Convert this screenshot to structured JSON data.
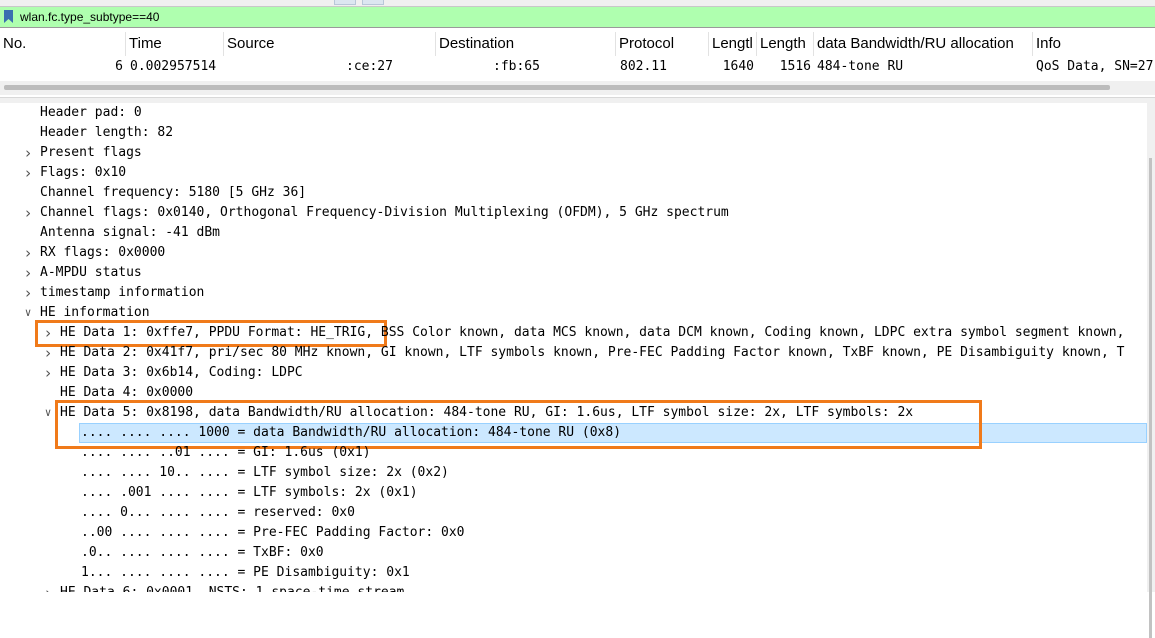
{
  "display_filter": {
    "value": "wlan.fc.type_subtype==40"
  },
  "packet_list": {
    "columns": [
      "No.",
      "Time",
      "Source",
      "Destination",
      "Protocol",
      "Lengtl",
      "Length",
      "data Bandwidth/RU allocation",
      "Info"
    ],
    "row": {
      "no": "6",
      "time": "0.002957514",
      "source": ":ce:27",
      "destination": ":fb:65",
      "protocol": "802.11",
      "length1": "1640",
      "length2": "1516",
      "bandwidth": "484-tone RU",
      "info": "QoS Data, SN=27"
    }
  },
  "details": [
    {
      "text": "Header pad: 0",
      "arrow": "none"
    },
    {
      "text": "Header length: 82",
      "arrow": "none"
    },
    {
      "text": "Present flags",
      "arrow": "collapsed"
    },
    {
      "text": "Flags: 0x10",
      "arrow": "collapsed"
    },
    {
      "text": "Channel frequency: 5180 [5 GHz 36]",
      "arrow": "none"
    },
    {
      "text": "Channel flags: 0x0140, Orthogonal Frequency-Division Multiplexing (OFDM), 5 GHz spectrum",
      "arrow": "collapsed"
    },
    {
      "text": "Antenna signal: -41 dBm",
      "arrow": "none"
    },
    {
      "text": "RX flags: 0x0000",
      "arrow": "collapsed"
    },
    {
      "text": "A-MPDU status",
      "arrow": "collapsed"
    },
    {
      "text": "timestamp information",
      "arrow": "collapsed"
    },
    {
      "text": "HE information",
      "arrow": "expanded"
    },
    {
      "text": "HE Data 1: 0xffe7, PPDU Format: HE_TRIG, BSS Color known, data MCS known, data DCM known, Coding known, LDPC extra symbol segment known,",
      "arrow": "collapsed"
    },
    {
      "text": "HE Data 2: 0x41f7, pri/sec 80 MHz known, GI known, LTF symbols known, Pre-FEC Padding Factor known, TxBF known, PE Disambiguity known, T",
      "arrow": "collapsed"
    },
    {
      "text": "HE Data 3: 0x6b14, Coding: LDPC",
      "arrow": "collapsed"
    },
    {
      "text": "HE Data 4: 0x0000",
      "arrow": "none"
    },
    {
      "text": "HE Data 5: 0x8198, data Bandwidth/RU allocation: 484-tone RU, GI: 1.6us, LTF symbol size: 2x, LTF symbols: 2x",
      "arrow": "expanded"
    },
    {
      "text": ".... .... .... 1000 = data Bandwidth/RU allocation: 484-tone RU (0x8)",
      "arrow": "none",
      "selected": true
    },
    {
      "text": ".... .... ..01 .... = GI: 1.6us (0x1)",
      "arrow": "none"
    },
    {
      "text": ".... .... 10.. .... = LTF symbol size: 2x (0x2)",
      "arrow": "none"
    },
    {
      "text": ".... .001 .... .... = LTF symbols: 2x (0x1)",
      "arrow": "none"
    },
    {
      "text": ".... 0... .... .... = reserved: 0x0",
      "arrow": "none"
    },
    {
      "text": "..00 .... .... .... = Pre-FEC Padding Factor: 0x0",
      "arrow": "none"
    },
    {
      "text": ".0.. .... .... .... = TxBF: 0x0",
      "arrow": "none"
    },
    {
      "text": "1... .... .... .... = PE Disambiguity: 0x1",
      "arrow": "none"
    },
    {
      "text": "HE Data 6: 0x0001, NSTS: 1 space-time stream",
      "arrow": "collapsed"
    }
  ],
  "colors": {
    "filter_valid": "#afffaf",
    "selection": "#cce8ff",
    "annotation": "#f07a1a"
  }
}
